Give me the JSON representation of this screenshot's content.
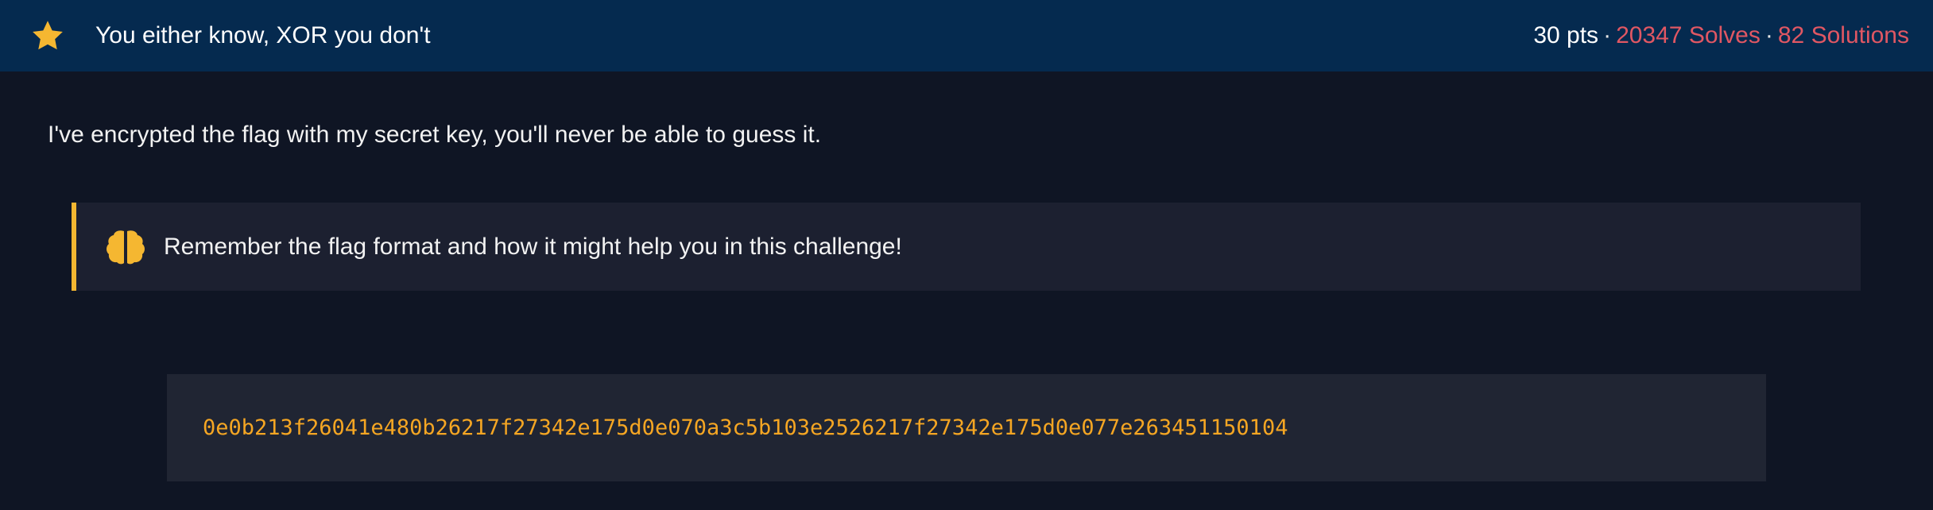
{
  "header": {
    "icon": "star-icon",
    "title": "You either know, XOR you don't",
    "points": "30 pts",
    "separator": "·",
    "solves": "20347 Solves",
    "solutions": "82 Solutions"
  },
  "description": "I've encrypted the flag with my secret key, you'll never be able to guess it.",
  "hint": {
    "icon": "brain-icon",
    "text": "Remember the flag format and how it might help you in this challenge!"
  },
  "ciphertext": "0e0b213f26041e480b26217f27342e175d0e070a3c5b103e2526217f27342e175d0e077e263451150104",
  "colors": {
    "header_bg": "#052a4f",
    "page_bg": "#0f1524",
    "accent": "#f5b731",
    "stat_red": "#e05763",
    "code_text": "#f5a623"
  }
}
